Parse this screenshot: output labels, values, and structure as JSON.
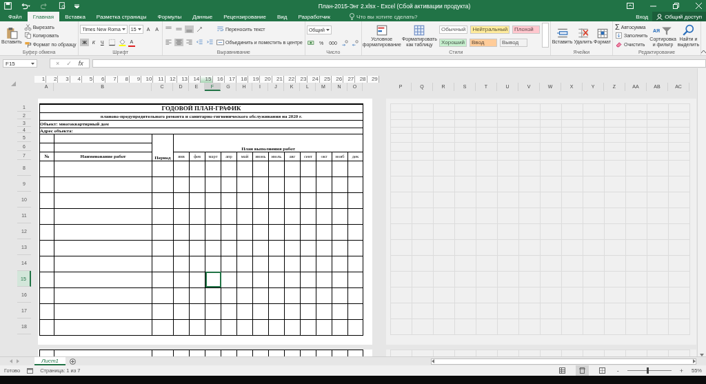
{
  "window": {
    "title": "План-2015-Энг 2.xlsx - Excel (Сбой активации продукта)"
  },
  "ribbon_tabs": [
    {
      "label": "Файл",
      "selected": false
    },
    {
      "label": "Главная",
      "selected": true
    },
    {
      "label": "Вставка",
      "selected": false
    },
    {
      "label": "Разметка страницы",
      "selected": false
    },
    {
      "label": "Формулы",
      "selected": false
    },
    {
      "label": "Данные",
      "selected": false
    },
    {
      "label": "Рецензирование",
      "selected": false
    },
    {
      "label": "Вид",
      "selected": false
    },
    {
      "label": "Разработчик",
      "selected": false
    }
  ],
  "tell_me": {
    "placeholder": "Что вы хотите сделать?"
  },
  "account": {
    "sign_in": "Вход",
    "share": "Общий доступ"
  },
  "ribbon": {
    "groups": [
      {
        "label": "Буфер обмена",
        "columns": [
          [
            [
              {
                "kind": "paste",
                "label": "Вставить"
              }
            ]
          ],
          [
            [
              {
                "kind": "cut",
                "label": "Вырезать"
              }
            ],
            [
              {
                "kind": "copy",
                "label": "Копировать"
              }
            ],
            [
              {
                "kind": "brush",
                "label": "Формат по образцу"
              }
            ]
          ]
        ]
      },
      {
        "label": "Шрифт",
        "columns": [
          [
            [
              {
                "kind": "field",
                "value": "Times New Roma"
              },
              {
                "kind": "field",
                "value": "15"
              },
              {
                "kind": "grow-font",
                "label": "A"
              },
              {
                "kind": "shrink-font",
                "label": "A"
              }
            ],
            [
              {
                "kind": "bold",
                "label": "Ж",
                "selected": true
              },
              {
                "kind": "italic",
                "label": "К",
                "selected": false
              },
              {
                "kind": "underline",
                "label": "Ч",
                "selected": false
              },
              {
                "kind": "borders"
              },
              {
                "kind": "fill-color"
              },
              {
                "kind": "font-color",
                "label": "A"
              }
            ]
          ]
        ]
      },
      {
        "label": "Выравнивание",
        "columns": [
          [
            [
              {
                "kind": "align-top",
                "selected": false
              },
              {
                "kind": "align-middle",
                "selected": false
              },
              {
                "kind": "align-bottom",
                "selected": true
              }
            ],
            [
              {
                "kind": "align-left",
                "selected": false
              },
              {
                "kind": "align-center",
                "selected": true
              },
              {
                "kind": "align-right",
                "selected": false
              }
            ]
          ],
          [
            [
              {
                "kind": "orientation"
              }
            ],
            [
              {
                "kind": "outdent"
              },
              {
                "kind": "indent"
              }
            ]
          ],
          [
            [
              {
                "kind": "wrap",
                "label": "Переносить текст"
              }
            ],
            [
              {
                "kind": "merge",
                "label": "Объединить и поместить в центре"
              }
            ]
          ]
        ]
      },
      {
        "label": "Число",
        "columns": [
          [
            [
              {
                "kind": "field",
                "value": "Общий"
              }
            ],
            [
              {
                "kind": "currency"
              },
              {
                "kind": "percent",
                "label": "%"
              },
              {
                "kind": "thousands",
                "label": "000"
              },
              {
                "kind": "inc-decimal"
              },
              {
                "kind": "dec-decimal"
              }
            ]
          ]
        ]
      },
      {
        "label": "Стили",
        "columns": [
          [
            [
              {
                "kind": "conditional",
                "label": "Условное форматирование"
              }
            ]
          ],
          [
            [
              {
                "kind": "table-format",
                "label": "Форматировать как таблицу"
              }
            ]
          ],
          [
            [
              {
                "kind": "style",
                "label": "Обычный",
                "color": "#ffffff"
              },
              {
                "kind": "style",
                "label": "Нейтральный",
                "color": "#ffeb9c"
              },
              {
                "kind": "style",
                "label": "Плохой",
                "color": "#ffc7ce"
              }
            ],
            [
              {
                "kind": "style",
                "label": "Хороший",
                "color": "#c6efce"
              },
              {
                "kind": "style",
                "label": "Ввод",
                "color": "#ffcc99"
              },
              {
                "kind": "style",
                "label": "Вывод",
                "color": "#f2f2f2"
              }
            ]
          ]
        ]
      },
      {
        "label": "Ячейки",
        "columns": [
          [
            [
              {
                "kind": "insert-cells",
                "label": "Вставить"
              }
            ]
          ],
          [
            [
              {
                "kind": "delete-cells",
                "label": "Удалить"
              }
            ]
          ],
          [
            [
              {
                "kind": "format-cells",
                "label": "Формат"
              }
            ]
          ]
        ]
      },
      {
        "label": "Редактирование",
        "columns": [
          [
            [
              {
                "kind": "sum",
                "glyph": "Σ",
                "label": "Автосумма"
              }
            ],
            [
              {
                "kind": "fill-down",
                "label": "Заполнить"
              }
            ],
            [
              {
                "kind": "eraser",
                "label": "Очистить"
              }
            ]
          ],
          [
            [
              {
                "kind": "sort",
                "glyph": "АЯ",
                "label": "Сортировка и фильтр"
              }
            ]
          ],
          [
            [
              {
                "kind": "search",
                "label": "Найти и выделить"
              }
            ]
          ]
        ]
      }
    ]
  },
  "formula_bar": {
    "name_box": "F15",
    "cancel": "×",
    "enter": "✓",
    "function": "fx"
  },
  "sheet": {
    "ruler": [
      {
        "label": "1",
        "selected": false
      },
      {
        "label": "2",
        "selected": false
      },
      {
        "label": "3",
        "selected": false
      },
      {
        "label": "4",
        "selected": false
      },
      {
        "label": "5",
        "selected": false
      },
      {
        "label": "6",
        "selected": false
      },
      {
        "label": "7",
        "selected": false
      },
      {
        "label": "8",
        "selected": false
      },
      {
        "label": "9",
        "selected": false
      },
      {
        "label": "10",
        "selected": false
      },
      {
        "label": "11",
        "selected": false
      },
      {
        "label": "12",
        "selected": false
      },
      {
        "label": "13",
        "selected": false
      },
      {
        "label": "14",
        "selected": false
      },
      {
        "label": "15",
        "selected": true
      },
      {
        "label": "16",
        "selected": false
      },
      {
        "label": "17",
        "selected": false
      },
      {
        "label": "18",
        "selected": false
      },
      {
        "label": "19",
        "selected": false
      },
      {
        "label": "20",
        "selected": false
      },
      {
        "label": "21",
        "selected": false
      },
      {
        "label": "22",
        "selected": false
      },
      {
        "label": "23",
        "selected": false
      },
      {
        "label": "24",
        "selected": false
      },
      {
        "label": "25",
        "selected": false
      },
      {
        "label": "26",
        "selected": false
      },
      {
        "label": "27",
        "selected": false
      },
      {
        "label": "28",
        "selected": false
      },
      {
        "label": "29",
        "selected": false
      }
    ],
    "columns": [
      {
        "label": "A",
        "selected": false
      },
      {
        "label": "B",
        "selected": false
      },
      {
        "label": "C",
        "selected": false
      },
      {
        "label": "D",
        "selected": false
      },
      {
        "label": "E",
        "selected": false
      },
      {
        "label": "F",
        "selected": true
      },
      {
        "label": "G",
        "selected": false
      },
      {
        "label": "H",
        "selected": false
      },
      {
        "label": "I",
        "selected": false
      },
      {
        "label": "J",
        "selected": false
      },
      {
        "label": "K",
        "selected": false
      },
      {
        "label": "L",
        "selected": false
      },
      {
        "label": "M",
        "selected": false
      },
      {
        "label": "N",
        "selected": false
      },
      {
        "label": "O",
        "selected": false
      }
    ],
    "columns_page_2": [
      {
        "label": "P",
        "selected": false
      },
      {
        "label": "Q",
        "selected": false
      },
      {
        "label": "R",
        "selected": false
      },
      {
        "label": "S",
        "selected": false
      },
      {
        "label": "T",
        "selected": false
      },
      {
        "label": "U",
        "selected": false
      },
      {
        "label": "V",
        "selected": false
      },
      {
        "label": "W",
        "selected": false
      },
      {
        "label": "X",
        "selected": false
      },
      {
        "label": "Y",
        "selected": false
      },
      {
        "label": "Z",
        "selected": false
      },
      {
        "label": "AA",
        "selected": false
      },
      {
        "label": "AB",
        "selected": false
      },
      {
        "label": "AC",
        "selected": false
      }
    ],
    "row_headers": [
      {
        "label": "1",
        "selected": false
      },
      {
        "label": "2",
        "selected": false
      },
      {
        "label": "3",
        "selected": false
      },
      {
        "label": "4",
        "selected": false
      },
      {
        "label": "5",
        "selected": false
      },
      {
        "label": "6",
        "selected": false
      },
      {
        "label": "7",
        "selected": false
      },
      {
        "label": "8",
        "selected": false
      },
      {
        "label": "9",
        "selected": false
      },
      {
        "label": "10",
        "selected": false
      },
      {
        "label": "11",
        "selected": false
      },
      {
        "label": "12",
        "selected": false
      },
      {
        "label": "13",
        "selected": false
      },
      {
        "label": "14",
        "selected": false
      },
      {
        "label": "15",
        "selected": true
      },
      {
        "label": "16",
        "selected": false
      },
      {
        "label": "17",
        "selected": false
      },
      {
        "label": "18",
        "selected": false
      }
    ],
    "table": {
      "title": "ГОДОВОЙ ПЛАН-ГРАФИК",
      "subtitle": "планово-предупредительного ремонта и санитарно-гигиенического обслуживания на 2020 г.",
      "object": "Объект: многоквартирный дом",
      "address": "Адрес объекта:",
      "number": "№",
      "name": "Наименование работ",
      "period": "Период",
      "plan": "План выполнения работ",
      "months": [
        "янв",
        "фев",
        "март",
        "апр",
        "май",
        "июнь",
        "июль",
        "авг",
        "сент",
        "окт",
        "нояб",
        "дек"
      ]
    }
  },
  "sheet_tabs": [
    {
      "label": "Лист1",
      "selected": true
    }
  ],
  "status_bar": {
    "status": "Готово",
    "page": "Страница: 1 из 7",
    "views": [
      {
        "kind": "normal",
        "selected": false
      },
      {
        "kind": "page-layout",
        "selected": true
      },
      {
        "kind": "page-break",
        "selected": false
      }
    ],
    "zoom_out": "-",
    "zoom_in": "+",
    "zoom": {
      "level": 0.45
    },
    "zoom_label": "55%"
  }
}
